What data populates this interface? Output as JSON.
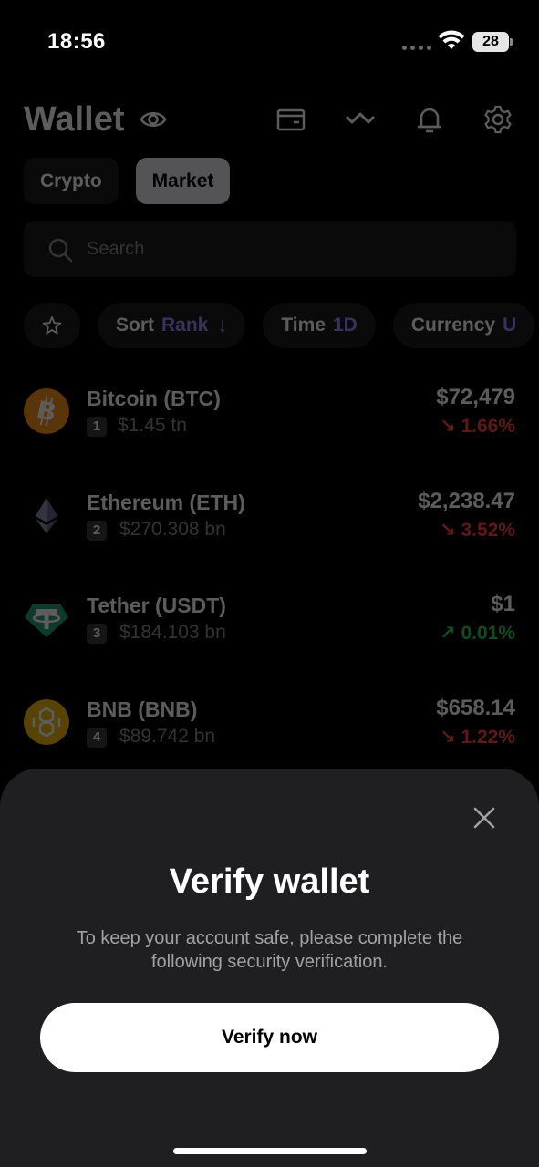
{
  "status_bar": {
    "time": "18:56",
    "battery": "28"
  },
  "header": {
    "title": "Wallet"
  },
  "tabs": [
    {
      "label": "Crypto",
      "active": false
    },
    {
      "label": "Market",
      "active": true
    }
  ],
  "search": {
    "placeholder": "Search"
  },
  "filters": {
    "sort_label": "Sort",
    "sort_value": "Rank",
    "time_label": "Time",
    "time_value": "1D",
    "currency_label": "Currency",
    "currency_value": "U"
  },
  "coins": [
    {
      "name": "Bitcoin (BTC)",
      "rank": "1",
      "market_cap": "$1.45 tn",
      "price": "$72,479",
      "change": "1.66%",
      "direction": "down",
      "logo_color": "#f7931a"
    },
    {
      "name": "Ethereum (ETH)",
      "rank": "2",
      "market_cap": "$270.308 bn",
      "price": "$2,238.47",
      "change": "3.52%",
      "direction": "down",
      "logo_color": "#8a92b2"
    },
    {
      "name": "Tether (USDT)",
      "rank": "3",
      "market_cap": "$184.103 bn",
      "price": "$1",
      "change": "0.01%",
      "direction": "up",
      "logo_color": "#26a17b"
    },
    {
      "name": "BNB (BNB)",
      "rank": "4",
      "market_cap": "$89.742 bn",
      "price": "$658.14",
      "change": "1.22%",
      "direction": "down",
      "logo_color": "#f0b90b"
    }
  ],
  "sheet": {
    "title": "Verify wallet",
    "description": "To keep your account safe, please complete the following security verification.",
    "button_label": "Verify now"
  },
  "colors": {
    "accent": "#9b8cff",
    "negative": "#ff453a",
    "positive": "#30d158",
    "sheet_bg": "#1f1f21"
  }
}
